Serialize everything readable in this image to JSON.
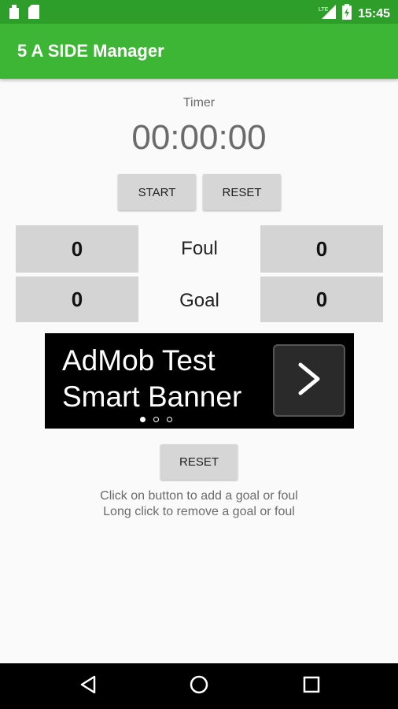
{
  "status_bar": {
    "time": "15:45",
    "icons": [
      "sd-card-icon",
      "sim-card-icon",
      "lte-signal-icon",
      "battery-charging-icon"
    ]
  },
  "app_bar": {
    "title": "5 A SIDE Manager"
  },
  "timer": {
    "label": "Timer",
    "value": "00:00:00"
  },
  "controls": {
    "start_label": "START",
    "reset_label": "RESET"
  },
  "score": {
    "foul": {
      "label": "Foul",
      "left": "0",
      "right": "0"
    },
    "goal": {
      "label": "Goal",
      "left": "0",
      "right": "0"
    }
  },
  "ad": {
    "line1": "AdMob Test",
    "line2": "Smart Banner",
    "arrow_icon": "chevron-right-icon",
    "page_count": 3,
    "active_page": 1
  },
  "bottom": {
    "reset_label": "RESET",
    "help_line1": "Click on button to add a goal or foul",
    "help_line2": "Long click to remove a goal or foul"
  },
  "nav": {
    "icons": [
      "back-icon",
      "home-icon",
      "recent-apps-icon"
    ]
  },
  "colors": {
    "status_bar": "#2e9e2a",
    "app_bar": "#3db535",
    "button": "#d6d6d6",
    "counter": "#d4d4d4"
  }
}
